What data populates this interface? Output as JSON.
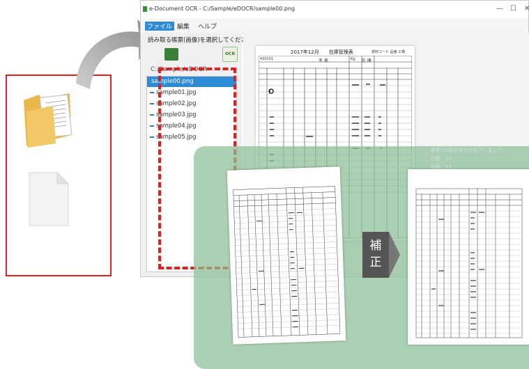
{
  "window": {
    "title": "e-Document OCR - C:/Sample/eDOCR/sample00.png",
    "controls": [
      "—",
      "☐",
      "✕"
    ]
  },
  "menu": [
    "ファイル",
    "編集",
    "ヘルプ"
  ],
  "left_pane": {
    "prompt": "読み取る帳票(画像)を選択してください。",
    "ocr_label": "OCR",
    "path": "C:/Sample/eDOCR",
    "files": [
      "sample00.png",
      "sample01.jpg",
      "sample02.jpg",
      "sample03.jpg",
      "sample04.jpg",
      "sample05.jpg"
    ],
    "selected_index": 0
  },
  "document": {
    "title": "2017年12月　　在庫管理表",
    "right_head": "部材コード 品番 工場",
    "row2_left": "430101",
    "row2_mid": "冬 表",
    "row2_unit": "Kg",
    "row2_right": "在 庫"
  },
  "status_text": [
    "帳票1の読み取りが完了しました。",
    "行数：27",
    "列数：13"
  ],
  "correction_label": [
    "補",
    "正"
  ],
  "colors": {
    "accent": "#2e8bd6",
    "dash": "#e02020",
    "green_panel": "#8cbe96"
  }
}
